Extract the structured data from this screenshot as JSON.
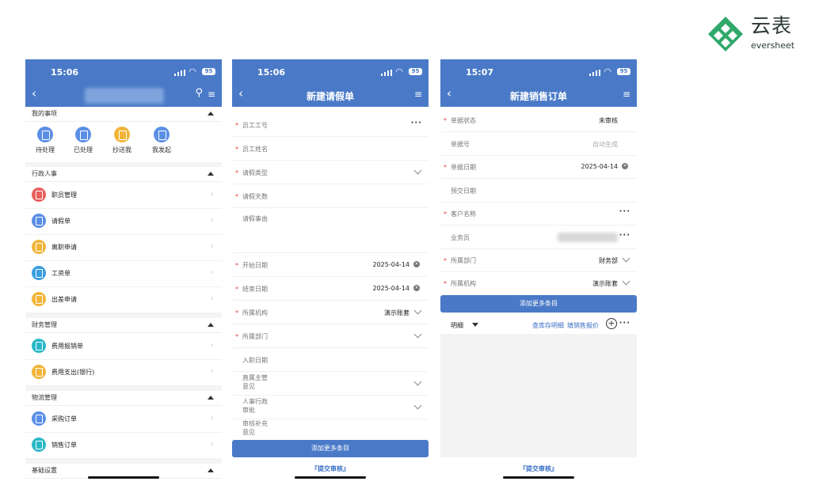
{
  "logo": {
    "cn": "云表",
    "en": "eversheet"
  },
  "phone1": {
    "time": "15:06",
    "battery": "95",
    "sections": {
      "my": "我的事项",
      "hr": "行政人事",
      "finance": "财务管理",
      "logistics": "物流管理",
      "basic": "基础设置"
    },
    "quick": [
      "待处理",
      "已处理",
      "抄送我",
      "我发起"
    ],
    "hr_items": [
      "职员管理",
      "请假单",
      "离职申请",
      "工资单",
      "出差申请"
    ],
    "finance_items": [
      "费用报销单",
      "费用支出(银行)"
    ],
    "logistics_items": [
      "采购订单",
      "销售订单"
    ]
  },
  "phone2": {
    "time": "15:06",
    "battery": "95",
    "title": "新建请假单",
    "fields": {
      "emp_no": "员工工号",
      "emp_name": "员工姓名",
      "leave_type": "请假类型",
      "leave_days": "请假天数",
      "reason": "请假事由",
      "start_date": "开始日期",
      "start_value": "2025-04-14",
      "end_date": "结束日期",
      "end_value": "2025-04-14",
      "org": "所属机构",
      "org_value": "演示账套",
      "dept": "所属部门",
      "join_date": "入职日期",
      "mgr_opinion": "直属主管\n意见",
      "hr_approval": "人事行政\n审批",
      "review_note": "审核补充\n意见"
    },
    "add_more": "添加更多条目",
    "submit": "『提交审核』"
  },
  "phone3": {
    "time": "15:07",
    "battery": "95",
    "title": "新建销售订单",
    "fields": {
      "status": "单据状态",
      "status_value": "未审核",
      "doc_no": "单据号",
      "doc_no_placeholder": "自动生成",
      "doc_date": "单据日期",
      "doc_date_value": "2025-04-14",
      "pre_date": "预交日期",
      "customer": "客户名称",
      "salesman": "业务员",
      "dept": "所属部门",
      "dept_value": "财务部",
      "org": "所属机构",
      "org_value": "演示账套"
    },
    "add_more": "添加更多条目",
    "detail": "明细",
    "stock_link": "查库存明细",
    "fill_price": "填销售报价",
    "submit": "『提交审核』"
  }
}
